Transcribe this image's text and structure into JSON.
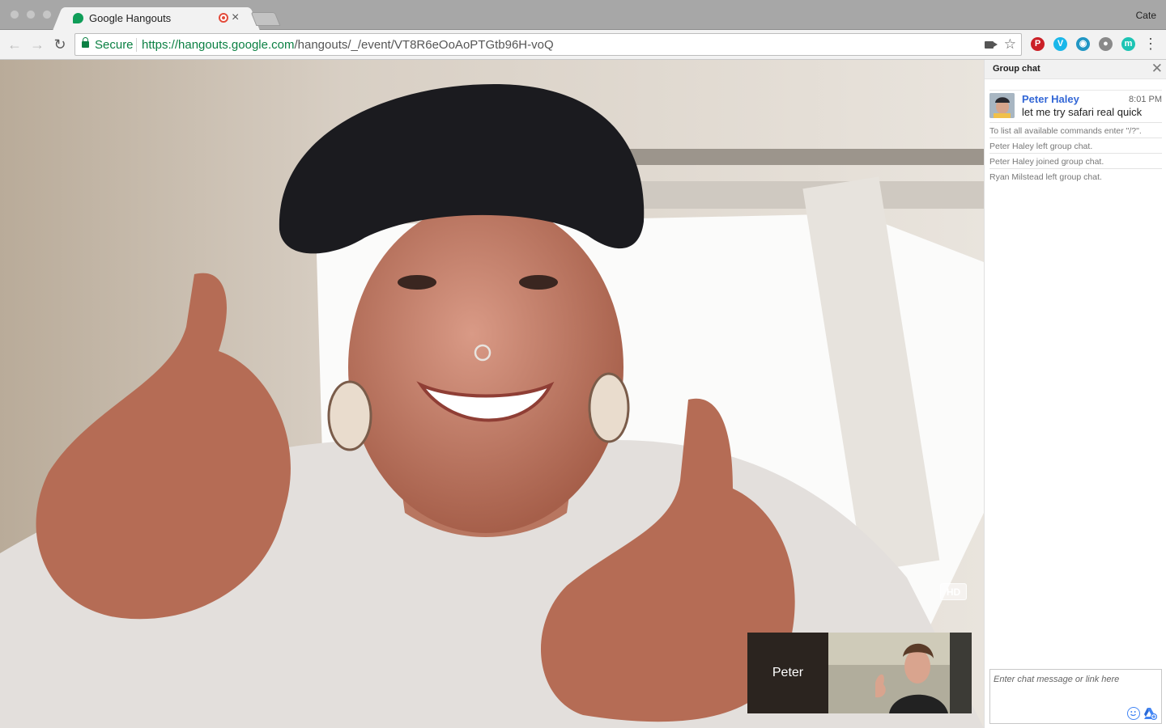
{
  "browser": {
    "tab_title": "Google Hangouts",
    "tab_close": "×",
    "profile_name": "Cate",
    "secure_label": "Secure",
    "url_scheme": "https://",
    "url_host": "hangouts.google.com",
    "url_path": "/hangouts/_/event/VT8R6eOoAoPTGtb96H-voQ",
    "extensions": [
      {
        "name": "pinterest-extension",
        "glyph": "P",
        "color": "#cb2027"
      },
      {
        "name": "vimeo-extension",
        "glyph": "V",
        "color": "#1ab7ea"
      },
      {
        "name": "circle-extension",
        "glyph": "◉",
        "color": "#2196c4"
      },
      {
        "name": "tomato-extension",
        "glyph": "●",
        "color": "#8a8a8a"
      },
      {
        "name": "m-extension",
        "glyph": "m",
        "color": "#1dc4b4"
      }
    ]
  },
  "video": {
    "hd_label": "HD",
    "participant_name": "Peter"
  },
  "chat": {
    "title": "Group chat",
    "close": "✕",
    "message": {
      "author": "Peter Haley",
      "time": "8:01 PM",
      "text": "let me try safari real quick"
    },
    "system_messages": [
      "To list all available commands enter \"/?\".",
      "Peter Haley left group chat.",
      "Peter Haley joined group chat.",
      "Ryan Milstead left group chat."
    ],
    "input_placeholder": "Enter chat message or link here"
  }
}
